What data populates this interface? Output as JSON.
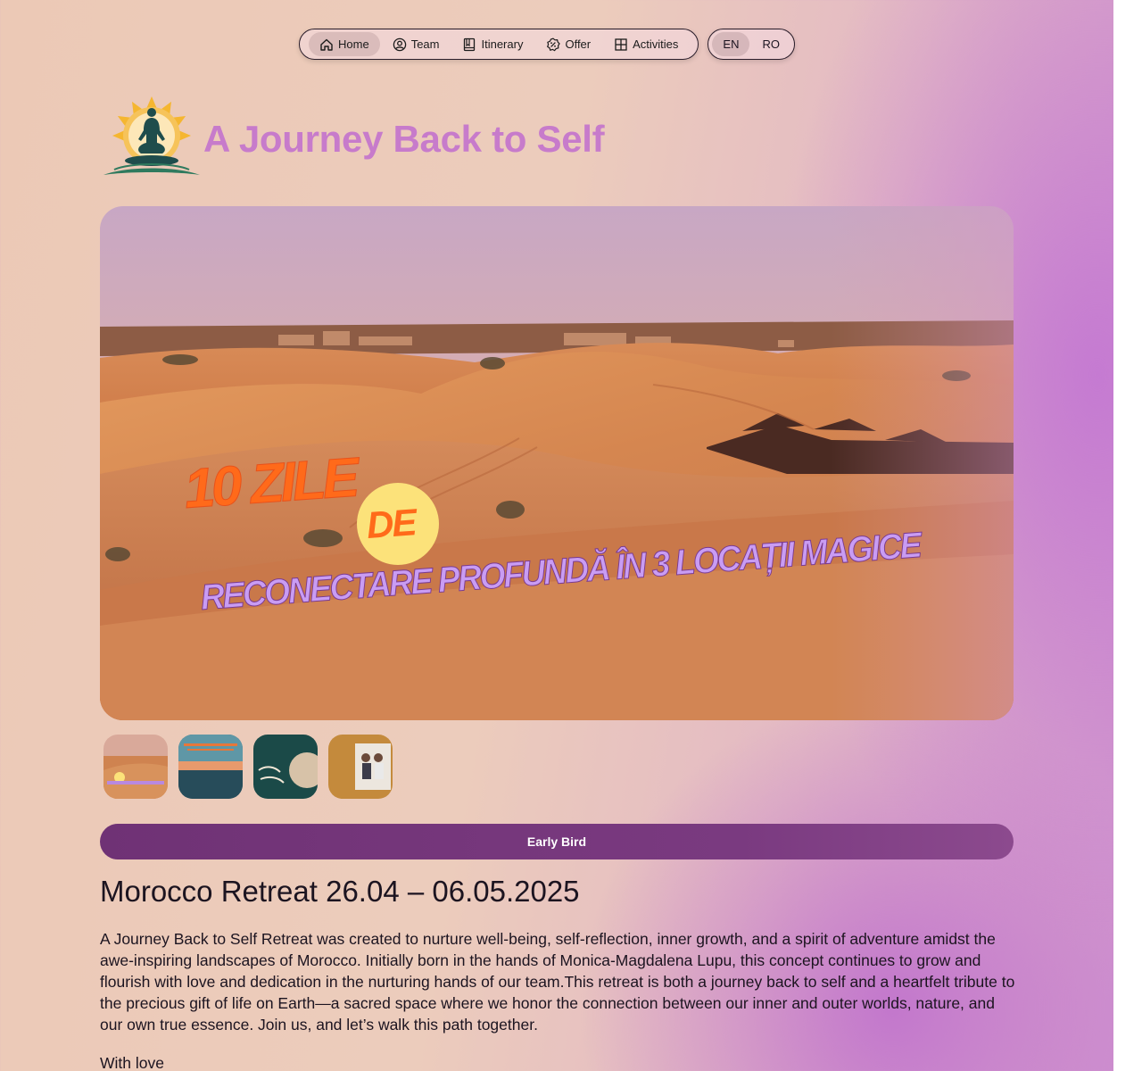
{
  "nav": {
    "items": [
      {
        "label": "Home",
        "icon": "home-icon",
        "active": true
      },
      {
        "label": "Team",
        "icon": "user-circle-icon",
        "active": false
      },
      {
        "label": "Itinerary",
        "icon": "book-icon",
        "active": false
      },
      {
        "label": "Offer",
        "icon": "discount-badge-icon",
        "active": false
      },
      {
        "label": "Activities",
        "icon": "grid-icon",
        "active": false
      }
    ],
    "languages": [
      {
        "label": "EN",
        "active": true
      },
      {
        "label": "RO",
        "active": false
      }
    ]
  },
  "header": {
    "title": "A Journey Back to Self",
    "logo": "lotus-meditation-logo"
  },
  "hero": {
    "line1": "10 ZILE",
    "line2": "DE",
    "line3": "RECONECTARE PROFUNDĂ ÎN 3 LOCAȚII MAGICE",
    "image": "sahara-desert-dunes"
  },
  "thumbnails": [
    {
      "name": "thumb-desert"
    },
    {
      "name": "thumb-sunset-sea"
    },
    {
      "name": "thumb-inspiration"
    },
    {
      "name": "thumb-team-photo"
    }
  ],
  "event": {
    "badge": "Early Bird",
    "title": "Morocco Retreat 26.04 – 06.05.2025",
    "description": "A Journey Back to Self Retreat was created to nurture well-being, self-reflection, inner growth, and a spirit of adventure amidst the awe-inspiring landscapes of Morocco. Initially born in the hands of Monica-Magdalena Lupu, this concept continues to grow and flourish with love and dedication in the nurturing hands of our team.This retreat is both a journey back to self and a heartfelt tribute to the precious gift of life on Earth—a sacred space where we honor the connection between our inner and outer worlds, nature, and our own true essence. Join us, and let’s walk this path together.",
    "signoff": "With love"
  },
  "colors": {
    "title": "#c77bcb",
    "badge": "#753679",
    "hero_text_orange": "#ff6a1a",
    "hero_text_lilac": "#c99cf3"
  }
}
